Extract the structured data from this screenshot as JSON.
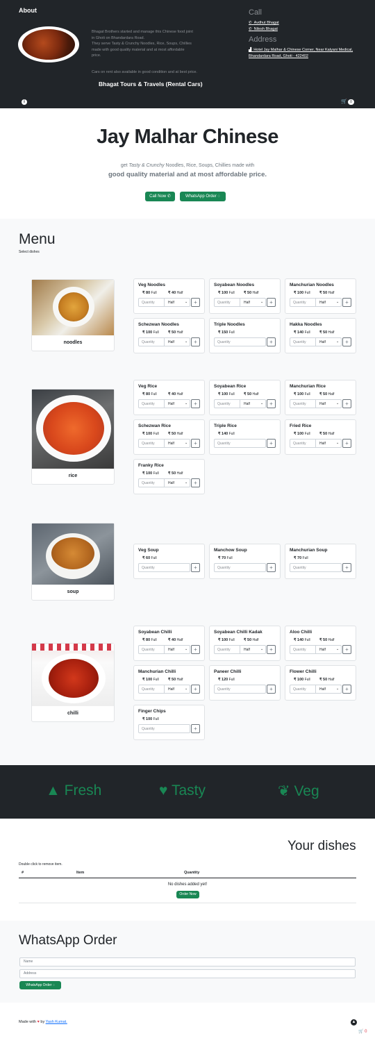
{
  "header": {
    "about": "About",
    "description": [
      "Bhagat Brothers started and manage this Chinese food joint",
      "in Ghoti on Bhandardara Road.",
      "They serve Tasty & Crunchy Noodles, Rice, Soups, Chillies",
      "made with good quality material and at most affordable",
      "price."
    ],
    "rent_note": "Cars on rent also available in good condition and at best price.",
    "tours": "Bhagat Tours & Travels (Rental Cars)",
    "call_heading": "Call",
    "call_1": "Avdhut Bhagat",
    "call_2": "Nilesh Bhagat",
    "address_heading": "Address",
    "address": "Hotel Jay Malhar & Chinese Corner, Near Kalyani Medical, Bhandardara Road, Ghoti - 422402",
    "cart_count": "0",
    "info_icon": "i"
  },
  "hero": {
    "title": "Jay Malhar Chinese",
    "sub_pre": "get ",
    "sub_em": "Tasty & Crunchy",
    "sub_post": " Noodles, Rice, Soups, Chillies made with",
    "sub2": "good quality material and at most affordable price.",
    "call_btn": "Call Now",
    "wa_btn": "WhatsApp Order"
  },
  "menu": {
    "title": "Menu",
    "subtitle": "Select dishes",
    "quantity_ph": "Quantity",
    "half_opt": "Half",
    "categories": [
      {
        "label": "noodles",
        "dishes": [
          {
            "name": "Veg Noodles",
            "full": "80",
            "half": "40"
          },
          {
            "name": "Soyabean Noodles",
            "full": "100",
            "half": "50"
          },
          {
            "name": "Manchurian Noodles",
            "full": "100",
            "half": "50"
          },
          {
            "name": "Schezwan Noodles",
            "full": "100",
            "half": "50"
          },
          {
            "name": "Triple Noodles",
            "full": "150",
            "half": null
          },
          {
            "name": "Hakka Noodles",
            "full": "140",
            "half": "50"
          }
        ]
      },
      {
        "label": "rice",
        "dishes": [
          {
            "name": "Veg Rice",
            "full": "80",
            "half": "40"
          },
          {
            "name": "Soyabean Rice",
            "full": "100",
            "half": "50"
          },
          {
            "name": "Manchurian Rice",
            "full": "100",
            "half": "50"
          },
          {
            "name": "Schezwan Rice",
            "full": "100",
            "half": "50"
          },
          {
            "name": "Triple Rice",
            "full": "140",
            "half": null
          },
          {
            "name": "Fried Rice",
            "full": "100",
            "half": "50"
          },
          {
            "name": "Franky Rice",
            "full": "100",
            "half": "50"
          }
        ]
      },
      {
        "label": "soup",
        "dishes": [
          {
            "name": "Veg Soup",
            "full": "60",
            "half": null
          },
          {
            "name": "Manchow Soup",
            "full": "70",
            "half": null
          },
          {
            "name": "Manchurian Soup",
            "full": "70",
            "half": null
          }
        ]
      },
      {
        "label": "chilli",
        "dishes": [
          {
            "name": "Soyabean Chilli",
            "full": "80",
            "half": "40"
          },
          {
            "name": "Soyabean Chilli Kadak",
            "full": "100",
            "half": "50"
          },
          {
            "name": "Aloo Chilli",
            "full": "140",
            "half": "50"
          },
          {
            "name": "Manchurian Chilli",
            "full": "100",
            "half": "50"
          },
          {
            "name": "Paneer Chilli",
            "full": "120",
            "half": null
          },
          {
            "name": "Flower Chilli",
            "full": "100",
            "half": "50"
          },
          {
            "name": "Finger Chips",
            "full": "100",
            "half": null
          }
        ]
      }
    ]
  },
  "features": [
    "Fresh",
    "Tasty",
    "Veg"
  ],
  "your_dishes": {
    "title": "Your dishes",
    "hint": "Double click to remove item.",
    "col_num": "#",
    "col_item": "Item",
    "col_qty": "Quantity",
    "empty": "No dishes added yet!",
    "order_btn": "Order Now"
  },
  "whatsapp": {
    "title": "WhatsApp Order",
    "name_ph": "Name",
    "address_ph": "Address",
    "btn": "WhatsApp Order"
  },
  "footer": {
    "made_with": "Made with",
    "by": "by",
    "author": "Yash Kumat.",
    "cart_count": "0"
  },
  "labels": {
    "rupee": "₹",
    "full": "Full",
    "half": "Half"
  },
  "colors": {
    "dark": "#212529",
    "green": "#198754",
    "light": "#f8f9fa"
  }
}
